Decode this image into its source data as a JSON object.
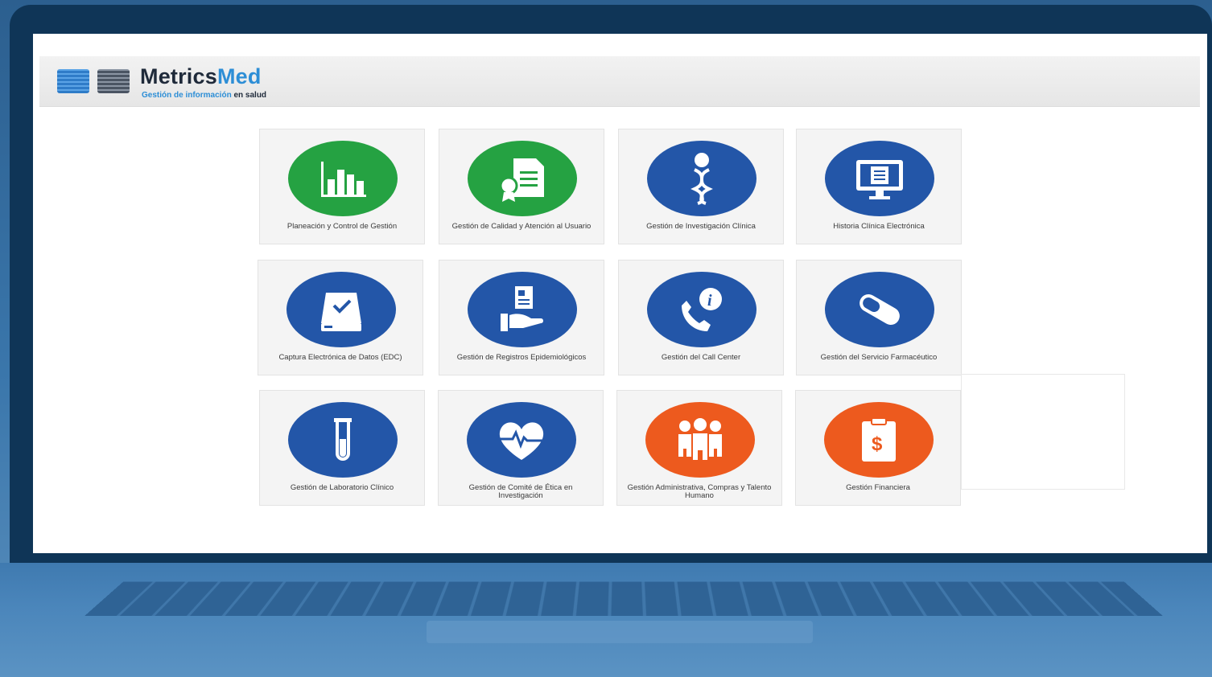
{
  "brand": {
    "name_part1": "Metrics",
    "name_part2": "Med",
    "tagline_part1": "Gestión de información",
    "tagline_part2": "en salud"
  },
  "colors": {
    "green": "#25a242",
    "blue": "#2356a8",
    "orange": "#ed5a1e",
    "brand_blue": "#2d8ed6"
  },
  "modules": [
    {
      "label": "Planeación y Control de Gestión",
      "icon": "bar-chart-icon",
      "color": "green"
    },
    {
      "label": "Gestión de Calidad y Atención al Usuario",
      "icon": "certificate-document-icon",
      "color": "green"
    },
    {
      "label": "Gestión de Investigación Clínica",
      "icon": "dna-icon",
      "color": "blue"
    },
    {
      "label": "Historia Clínica Electrónica",
      "icon": "monitor-record-icon",
      "color": "blue"
    },
    {
      "label": "Captura Electrónica de Datos (EDC)",
      "icon": "drive-check-icon",
      "color": "blue"
    },
    {
      "label": "Gestión de Registros Epidemiológicos",
      "icon": "hand-document-icon",
      "color": "blue"
    },
    {
      "label": "Gestión del Call Center",
      "icon": "phone-info-icon",
      "color": "blue"
    },
    {
      "label": "Gestión del Servicio Farmacéutico",
      "icon": "pill-icon",
      "color": "blue"
    },
    {
      "label": "Gestión de Laboratorio Clínico",
      "icon": "test-tube-icon",
      "color": "blue"
    },
    {
      "label": "Gestión de Comité de Ética en Investigación",
      "icon": "heart-pulse-icon",
      "color": "blue"
    },
    {
      "label": "Gestión Administrativa, Compras y Talento Humano",
      "icon": "team-icon",
      "color": "orange"
    },
    {
      "label": "Gestión Financiera",
      "icon": "clipboard-dollar-icon",
      "color": "orange"
    }
  ]
}
